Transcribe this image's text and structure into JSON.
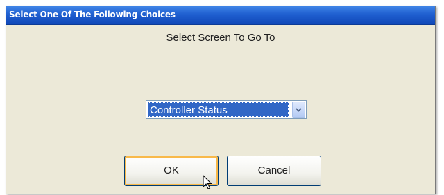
{
  "dialog": {
    "title": "Select One Of The Following Choices",
    "prompt": "Select Screen To Go To",
    "dropdown": {
      "selected": "Controller Status",
      "icon": "chevron-down-icon"
    },
    "buttons": {
      "ok_label": "OK",
      "cancel_label": "Cancel"
    },
    "cursor_icon": "mouse-pointer-icon"
  }
}
